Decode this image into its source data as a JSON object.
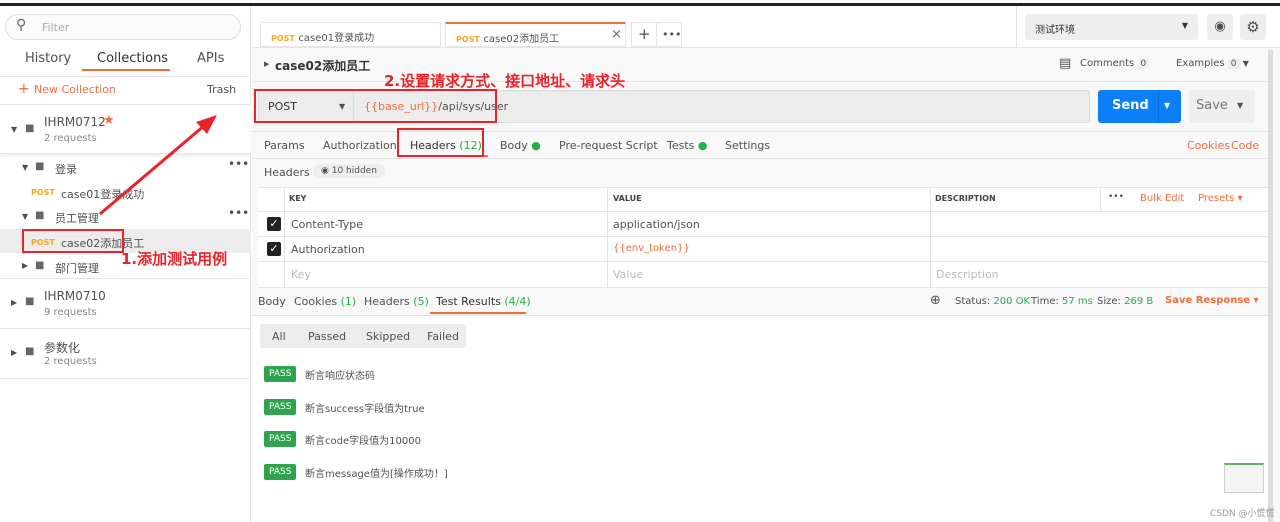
{
  "sidebar": {
    "filter_placeholder": "Filter",
    "tabs": [
      "History",
      "Collections",
      "APIs"
    ],
    "new_collection": "New Collection",
    "trash": "Trash",
    "collections": [
      {
        "name": "IHRM0712",
        "count": "2 requests"
      },
      {
        "name": "IHRM0710",
        "count": "9 requests"
      },
      {
        "name": "参数化",
        "count": "2 requests"
      }
    ],
    "folders": [
      "登录",
      "员工管理",
      "部门管理"
    ],
    "requests": [
      {
        "method": "POST",
        "name": "case01登录成功"
      },
      {
        "method": "POST",
        "name": "case02添加员工"
      }
    ]
  },
  "tabs": [
    {
      "method": "POST",
      "name": "case01登录成功"
    },
    {
      "method": "POST",
      "name": "case02添加员工"
    }
  ],
  "env": {
    "selected": "测试环境"
  },
  "request": {
    "name": "case02添加员工",
    "comments": "Comments",
    "comments_count": "0",
    "examples": "Examples",
    "examples_count": "0",
    "method": "POST",
    "url_var": "{{base_url}}",
    "url_path": "/api/sys/user",
    "send": "Send",
    "save": "Save"
  },
  "req_tabs": {
    "params": "Params",
    "authorization": "Authorization",
    "headers": "Headers",
    "headers_count": "(12)",
    "body": "Body",
    "prerequest": "Pre-request Script",
    "tests": "Tests",
    "settings": "Settings",
    "cookies": "Cookies",
    "code": "Code"
  },
  "headers": {
    "label": "Headers",
    "hidden": "10 hidden",
    "columns": [
      "KEY",
      "VALUE",
      "DESCRIPTION"
    ],
    "bulk_edit": "Bulk Edit",
    "presets": "Presets",
    "rows": [
      {
        "key": "Content-Type",
        "value": "application/json"
      },
      {
        "key": "Authorization",
        "value": "{{env_token}}"
      }
    ],
    "placeholder": {
      "key": "Key",
      "value": "Value",
      "description": "Description"
    }
  },
  "response": {
    "tabs": {
      "body": "Body",
      "cookies": "Cookies",
      "cookies_count": "(1)",
      "headers": "Headers",
      "headers_count": "(5)",
      "tests": "Test Results",
      "tests_count": "(4/4)"
    },
    "status_label": "Status:",
    "status": "200 OK",
    "time_label": "Time:",
    "time": "57 ms",
    "size_label": "Size:",
    "size": "269 B",
    "save": "Save Response",
    "filters": [
      "All",
      "Passed",
      "Skipped",
      "Failed"
    ],
    "results": [
      {
        "status": "PASS",
        "name": "断言响应状态码"
      },
      {
        "status": "PASS",
        "name": "断言success字段值为true"
      },
      {
        "status": "PASS",
        "name": "断言code字段值为10000"
      },
      {
        "status": "PASS",
        "name": "断言message值为[操作成功！]"
      }
    ]
  },
  "annotations": {
    "step1": "1.添加测试用例",
    "step2": "2.设置请求方式、接口地址、请求头"
  },
  "watermark": "CSDN @小慌慌"
}
